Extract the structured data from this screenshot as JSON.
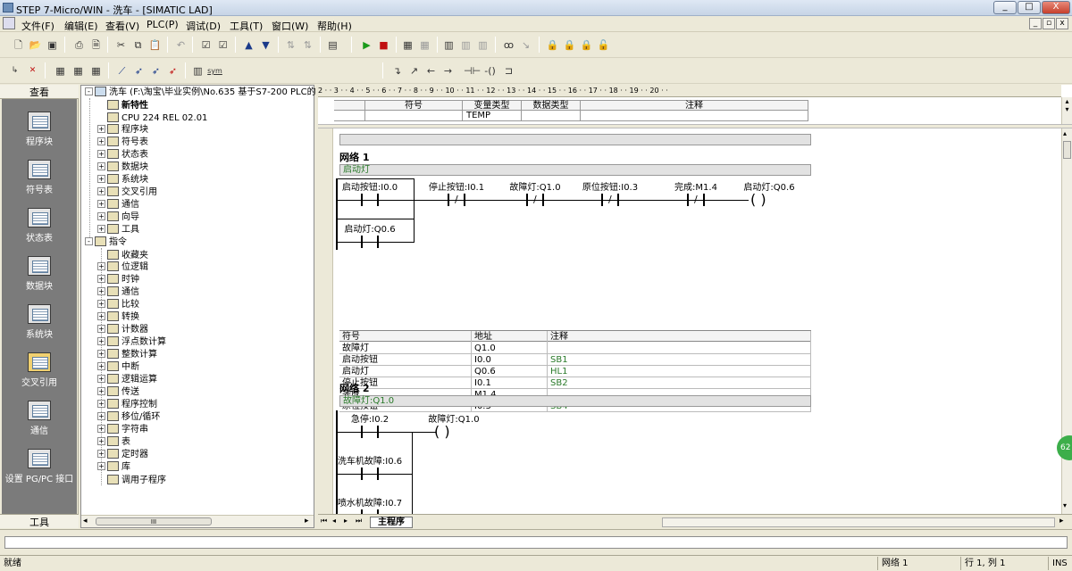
{
  "window": {
    "title": "STEP 7-Micro/WIN - 洗车 - [SIMATIC LAD]",
    "minimize": "_",
    "maximize": "□",
    "close": "X"
  },
  "menu": [
    "文件(F)",
    "编辑(E)",
    "查看(V)",
    "PLC(P)",
    "调试(D)",
    "工具(T)",
    "窗口(W)",
    "帮助(H)"
  ],
  "mdi": {
    "min": "_",
    "restore": "▫",
    "close": "x"
  },
  "toolbar2": {
    "sym": "sym"
  },
  "view_panel": {
    "header": "查看",
    "footer": "工具",
    "items": [
      "程序块",
      "符号表",
      "状态表",
      "数据块",
      "系统块",
      "交叉引用",
      "通信",
      "设置 PG/PC 接口"
    ]
  },
  "tree": {
    "root": "洗车 (F:\\淘宝\\毕业实例\\No.635 基于S7-200 PLC的",
    "items": [
      {
        "label": "新特性",
        "bold": true,
        "level": 1,
        "exp": ""
      },
      {
        "label": "CPU 224 REL 02.01",
        "level": 1,
        "exp": ""
      },
      {
        "label": "程序块",
        "level": 1,
        "exp": "+"
      },
      {
        "label": "符号表",
        "level": 1,
        "exp": "+"
      },
      {
        "label": "状态表",
        "level": 1,
        "exp": "+"
      },
      {
        "label": "数据块",
        "level": 1,
        "exp": "+"
      },
      {
        "label": "系统块",
        "level": 1,
        "exp": "+"
      },
      {
        "label": "交叉引用",
        "level": 1,
        "exp": "+"
      },
      {
        "label": "通信",
        "level": 1,
        "exp": "+"
      },
      {
        "label": "向导",
        "level": 1,
        "exp": "+"
      },
      {
        "label": "工具",
        "level": 1,
        "exp": "+"
      },
      {
        "label": "指令",
        "level": 0,
        "exp": "-"
      },
      {
        "label": "收藏夹",
        "level": 1,
        "exp": ""
      },
      {
        "label": "位逻辑",
        "level": 1,
        "exp": "+"
      },
      {
        "label": "时钟",
        "level": 1,
        "exp": "+"
      },
      {
        "label": "通信",
        "level": 1,
        "exp": "+"
      },
      {
        "label": "比较",
        "level": 1,
        "exp": "+"
      },
      {
        "label": "转换",
        "level": 1,
        "exp": "+"
      },
      {
        "label": "计数器",
        "level": 1,
        "exp": "+"
      },
      {
        "label": "浮点数计算",
        "level": 1,
        "exp": "+"
      },
      {
        "label": "整数计算",
        "level": 1,
        "exp": "+"
      },
      {
        "label": "中断",
        "level": 1,
        "exp": "+"
      },
      {
        "label": "逻辑运算",
        "level": 1,
        "exp": "+"
      },
      {
        "label": "传送",
        "level": 1,
        "exp": "+"
      },
      {
        "label": "程序控制",
        "level": 1,
        "exp": "+"
      },
      {
        "label": "移位/循环",
        "level": 1,
        "exp": "+"
      },
      {
        "label": "字符串",
        "level": 1,
        "exp": "+"
      },
      {
        "label": "表",
        "level": 1,
        "exp": "+"
      },
      {
        "label": "定时器",
        "level": 1,
        "exp": "+"
      },
      {
        "label": "库",
        "level": 1,
        "exp": "+"
      },
      {
        "label": "调用子程序",
        "level": 1,
        "exp": ""
      }
    ],
    "hscroll_thumb": "III"
  },
  "ruler": "2 · · 3 · · 4 · · 5 · · 6 · · 7 · · 8 · · 9 · · 10 · · 11 · · 12 · · 13 · · 14 · · 15 · · 16 · · 17 · · 18 · · 19 · · 20 · ·",
  "var_table": {
    "headers": [
      "符号",
      "变量类型",
      "数据类型",
      "注释"
    ],
    "row1_type": "TEMP"
  },
  "network1": {
    "title": "网络 1",
    "comment": "启动灯",
    "contacts": [
      {
        "label": "启动按钮:I0.0",
        "nc": false
      },
      {
        "label": "停止按钮:I0.1",
        "nc": true
      },
      {
        "label": "故障灯:Q1.0",
        "nc": true
      },
      {
        "label": "原位按钮:I0.3",
        "nc": true
      },
      {
        "label": "完成:M1.4",
        "nc": true
      }
    ],
    "coil": "启动灯:Q0.6",
    "parallel": "启动灯:Q0.6",
    "symbols": {
      "headers": [
        "符号",
        "地址",
        "注释"
      ],
      "rows": [
        [
          "故障灯",
          "Q1.0",
          ""
        ],
        [
          "启动按钮",
          "I0.0",
          "SB1"
        ],
        [
          "启动灯",
          "Q0.6",
          "HL1"
        ],
        [
          "停止按钮",
          "I0.1",
          "SB2"
        ],
        [
          "完成",
          "M1.4",
          ""
        ],
        [
          "原位按钮",
          "I0.3",
          "SB4"
        ]
      ]
    }
  },
  "network2": {
    "title": "网络 2",
    "comment": "故障灯:Q1.0",
    "contacts": [
      "急停:I0.2",
      "洗车机故障:I0.6",
      "喷水机故障:I0.7"
    ],
    "coil": "故障灯:Q1.0"
  },
  "tabs": {
    "main": "主程序"
  },
  "status": {
    "left": "就绪",
    "network": "网络 1",
    "position": "行 1, 列 1",
    "mode": "INS"
  },
  "badge": "62",
  "colors": {
    "comment_green": "#2a7a2a",
    "panel_gray": "#7b7b7b",
    "chrome": "#ece9d8"
  }
}
